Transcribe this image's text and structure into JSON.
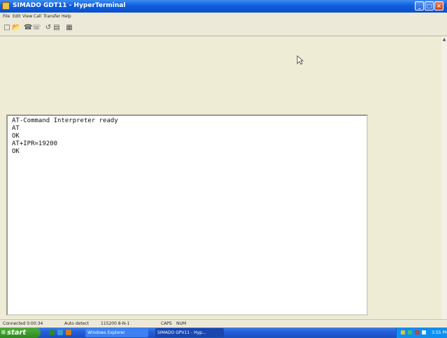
{
  "window": {
    "title": "SIMADO GDT11 - HyperTerminal",
    "controls": {
      "minimize": "_",
      "maximize": "□",
      "close": "×"
    }
  },
  "menu": {
    "items": [
      "File",
      "Edit",
      "View",
      "Call",
      "Transfer",
      "Help"
    ]
  },
  "toolbar": {
    "icons": [
      "new-icon",
      "open-icon",
      "disconnect-icon",
      "connect-icon",
      "send-icon",
      "receive-icon",
      "properties-icon"
    ]
  },
  "terminal": {
    "lines": [
      "AT-Command Interpreter ready",
      "AT",
      "OK",
      "AT+IPR=19200",
      "OK"
    ]
  },
  "statusbar": {
    "connected": "Connected 0:00:34",
    "detect": "Auto detect",
    "settings": "115200 8-N-1",
    "caps": "CAPS",
    "num": "NUM"
  },
  "taskbar": {
    "start_label": "start",
    "start_logo": "⊞",
    "tasks": [
      "Windows Explorer",
      "SIMADO GPV11 - Hyp..."
    ],
    "clock": "3:55 PM"
  },
  "colors": {
    "titlebar": "#0d5ee0",
    "taskbar": "#245edb",
    "start_button": "#2f8a22",
    "terminal_bg": "#ffffff",
    "window_bg": "#ece9d8"
  }
}
